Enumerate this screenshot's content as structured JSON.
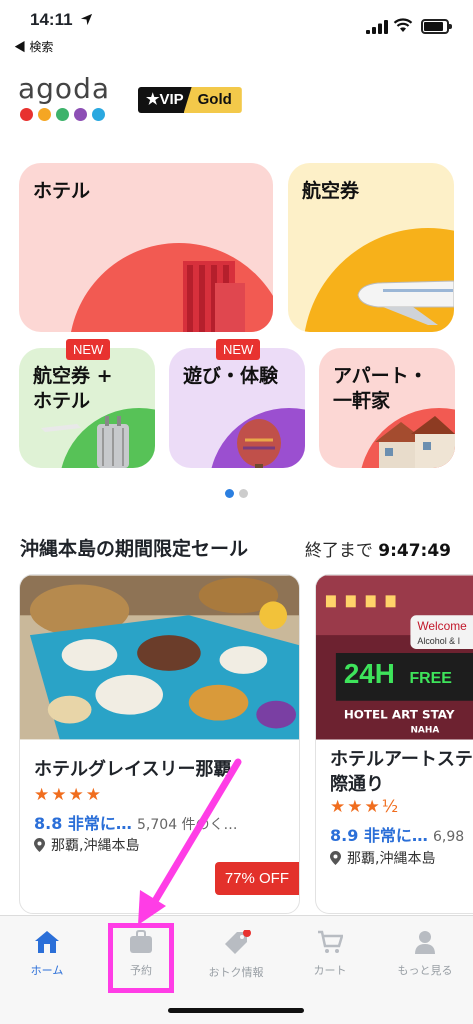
{
  "status_bar": {
    "time": "14:11",
    "back_label": "◀ 検索"
  },
  "header": {
    "logo_text": "agoda",
    "logo_dot_colors": [
      "#e8322f",
      "#f5a623",
      "#3db36b",
      "#8d4fb5",
      "#2aa8e0"
    ],
    "vip_left": "★VIP",
    "vip_right": "Gold"
  },
  "tiles": [
    {
      "label": "ホテル",
      "bg": "#fcd7d4",
      "accent": "#f25a52"
    },
    {
      "label": "航空券",
      "bg": "#fdf0c8",
      "accent": "#f7b11a"
    },
    {
      "label": "航空券 +\nホテル",
      "bg": "#dff2d5",
      "accent": "#57c257",
      "badge": "NEW"
    },
    {
      "label": "遊び・体験",
      "bg": "#ecdcf7",
      "accent": "#9b4fd0",
      "badge": "NEW"
    },
    {
      "label": "アパート・\n一軒家",
      "bg": "#fcd7d4",
      "accent": "#f25a52"
    }
  ],
  "sale": {
    "title": "沖縄本島の期間限定セール",
    "countdown_label": "終了まで",
    "countdown_value": "9:47:49",
    "cards": [
      {
        "name": "ホテルグレイスリー那覇",
        "stars": "★★★★",
        "score": "8.8 非常に…",
        "reviews": "5,704 件のく…",
        "location": "那覇,沖縄本島",
        "discount": "77% OFF"
      },
      {
        "name": "ホテルアートステ\n際通り",
        "stars": "★★★½",
        "score": "8.9 非常に…",
        "reviews": "6,98",
        "location": "那覇,沖縄本島",
        "sign_24h": "24H",
        "sign_free": "FREE",
        "sign_welcome": "Welcome",
        "sign_alcohol": "Alcohol & I",
        "sign_hotel": "HOTEL ART STAY",
        "sign_naha": "NAHA"
      }
    ]
  },
  "tabbar": {
    "tabs": [
      {
        "label": "ホーム",
        "icon": "home-icon"
      },
      {
        "label": "予約",
        "icon": "briefcase-icon"
      },
      {
        "label": "おトク情報",
        "icon": "tag-icon"
      },
      {
        "label": "カート",
        "icon": "cart-icon"
      },
      {
        "label": "もっと見る",
        "icon": "person-icon"
      }
    ],
    "active_color": "#2b6fd8",
    "inactive_color": "#9aa0a6",
    "annotation_color": "#ff3de6"
  }
}
